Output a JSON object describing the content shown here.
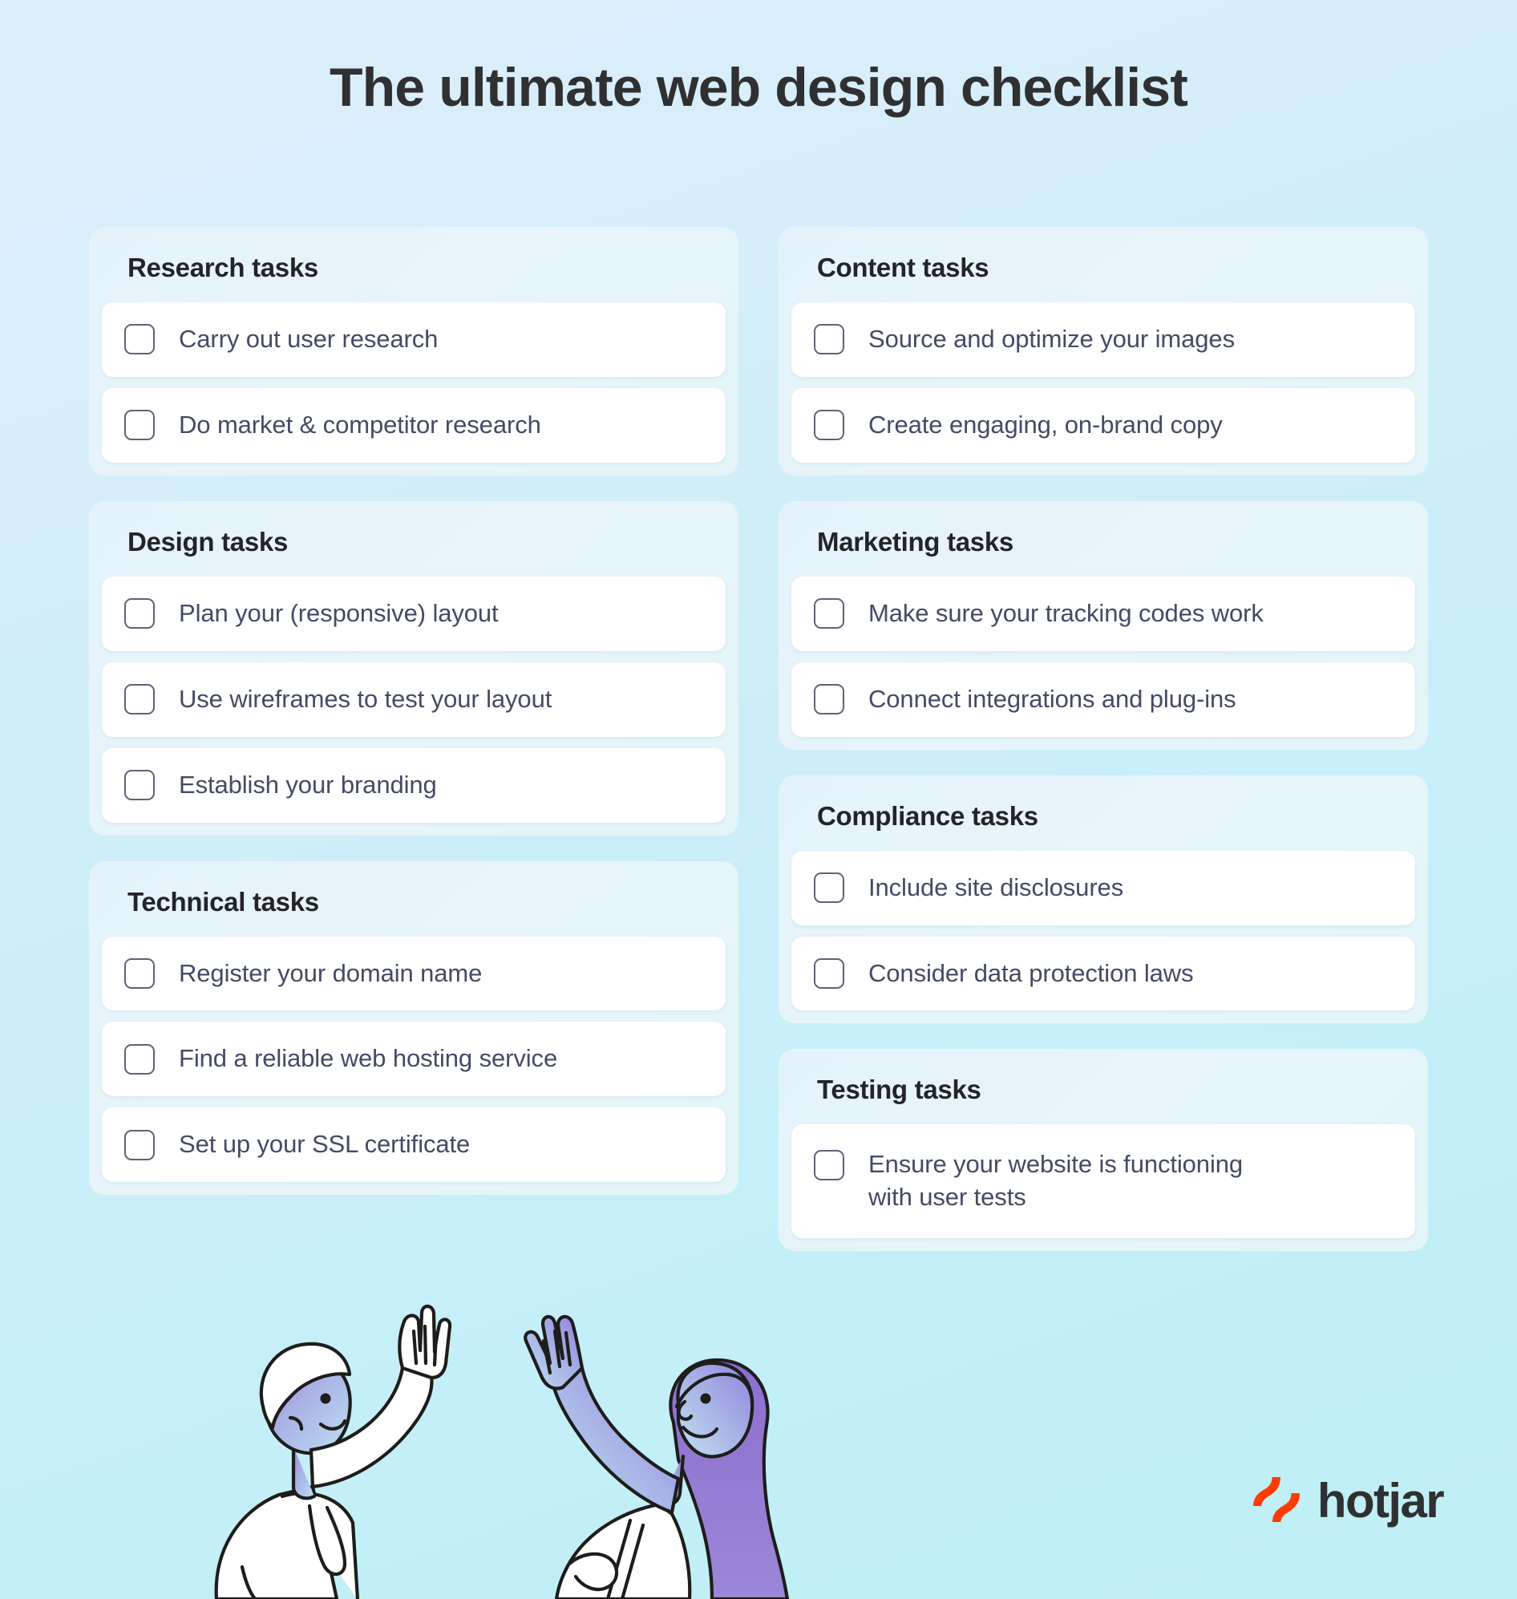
{
  "page": {
    "title": "The ultimate web design checklist",
    "background_gradient_from": "#dceefa",
    "background_gradient_to": "#c0eff5"
  },
  "columns": [
    {
      "name": "left-column",
      "sections": [
        {
          "id": "research",
          "heading": "Research tasks",
          "tasks": [
            {
              "label": "Carry out user research",
              "checked": false
            },
            {
              "label": "Do market & competitor research",
              "checked": false
            }
          ]
        },
        {
          "id": "design",
          "heading": "Design tasks",
          "tasks": [
            {
              "label": "Plan your (responsive) layout",
              "checked": false
            },
            {
              "label": "Use wireframes to test your layout",
              "checked": false
            },
            {
              "label": "Establish your branding",
              "checked": false
            }
          ]
        },
        {
          "id": "technical",
          "heading": "Technical tasks",
          "tasks": [
            {
              "label": "Register your domain name",
              "checked": false
            },
            {
              "label": "Find a reliable web hosting service",
              "checked": false
            },
            {
              "label": "Set up your SSL certificate",
              "checked": false
            }
          ]
        }
      ]
    },
    {
      "name": "right-column",
      "sections": [
        {
          "id": "content",
          "heading": "Content tasks",
          "tasks": [
            {
              "label": "Source and optimize your images",
              "checked": false
            },
            {
              "label": "Create engaging, on-brand copy",
              "checked": false
            }
          ]
        },
        {
          "id": "marketing",
          "heading": "Marketing tasks",
          "tasks": [
            {
              "label": "Make sure your tracking codes work",
              "checked": false
            },
            {
              "label": "Connect integrations and plug-ins",
              "checked": false
            }
          ]
        },
        {
          "id": "compliance",
          "heading": "Compliance tasks",
          "tasks": [
            {
              "label": "Include site disclosures",
              "checked": false
            },
            {
              "label": "Consider data protection laws",
              "checked": false
            }
          ]
        },
        {
          "id": "testing",
          "heading": "Testing tasks",
          "tasks": [
            {
              "label": "Ensure your website is functioning with user tests",
              "checked": false
            }
          ]
        }
      ]
    }
  ],
  "logo": {
    "wordmark": "hotjar",
    "mark_icon": "hotjar-flame-icon",
    "mark_color": "#ff3c00",
    "word_color": "#2f3031"
  },
  "illustration": {
    "name": "two-people-high-five-illustration",
    "skin_gradient_from": "#9b8fdd",
    "skin_gradient_to": "#b9dcef",
    "hair_color": "#8b6fce",
    "outline_color": "#1d1d1b"
  },
  "theme": {
    "card_background": "#e5f4fb",
    "row_background": "#ffffff",
    "checkbox_border": "#5f6278",
    "task_text": "#454a66",
    "heading_text": "#23242a"
  }
}
